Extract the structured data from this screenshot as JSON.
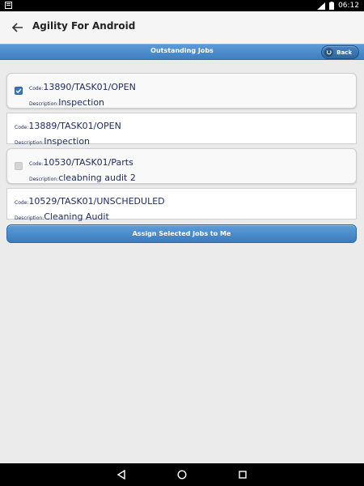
{
  "status_bar": {
    "time": "06:12"
  },
  "app_bar": {
    "title": "Agility For Android"
  },
  "header": {
    "title": "Outstanding Jobs",
    "back_label": "Back"
  },
  "labels": {
    "code": "Code:",
    "description": "Description:"
  },
  "jobs": [
    {
      "code": "13890/TASK01/OPEN",
      "description": "Inspection",
      "checkbox": "checked"
    },
    {
      "code": "13889/TASK01/OPEN",
      "description": "Inspection",
      "checkbox": "none"
    },
    {
      "code": "10530/TASK01/Parts",
      "description": "cleabning audit 2",
      "checkbox": "unchecked"
    },
    {
      "code": "10529/TASK01/UNSCHEDULED",
      "description": "Cleaning Audit",
      "checkbox": "none"
    }
  ],
  "assign_button": {
    "label": "Assign Selected Jobs to Me"
  },
  "colors": {
    "accent": "#3f7fbf",
    "text": "#1a2b5f"
  }
}
